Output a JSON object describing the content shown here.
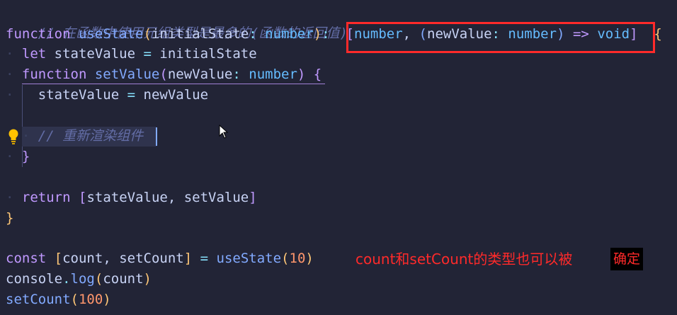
{
  "code": {
    "comment_top": "// 在函数中使用元组类型是最多的(函数的返回值)",
    "kw_function": "function",
    "fn_useState": "useState",
    "param_initialState": "initialState",
    "colon": ":",
    "type_number": "number",
    "paren_open": "(",
    "paren_close": ")",
    "bracket_open": "[",
    "bracket_close": "]",
    "comma_space": ", ",
    "param_newValue": "newValue",
    "arrow": "=>",
    "type_void": "void",
    "brace_open": "{",
    "brace_close": "}",
    "kw_let": "let",
    "var_stateValue": "stateValue",
    "assign": "=",
    "var_initialState": "initialState",
    "fn_setValue": "setValue",
    "var_newValue": "newValue",
    "comment_inner": "// 重新渲染组件",
    "kw_return": "return",
    "var_setValue": "setValue",
    "kw_const": "const",
    "var_count": "count",
    "var_setCount": "setCount",
    "num_10": "10",
    "obj_console": "console",
    "dot": ".",
    "fn_log": "log",
    "num_100": "100"
  },
  "annotation": {
    "text": "count和setCount的类型也可以被",
    "tail": "确定"
  },
  "colors": {
    "background": "#222436",
    "keyword": "#c099ff",
    "function": "#82aaff",
    "type": "#65bcff",
    "number": "#ff966c",
    "highlight_box": "#ff2a2a",
    "comment": "#636da6"
  },
  "icons": {
    "lightbulb": "lightbulb-icon",
    "cursor": "mouse-pointer-icon"
  }
}
